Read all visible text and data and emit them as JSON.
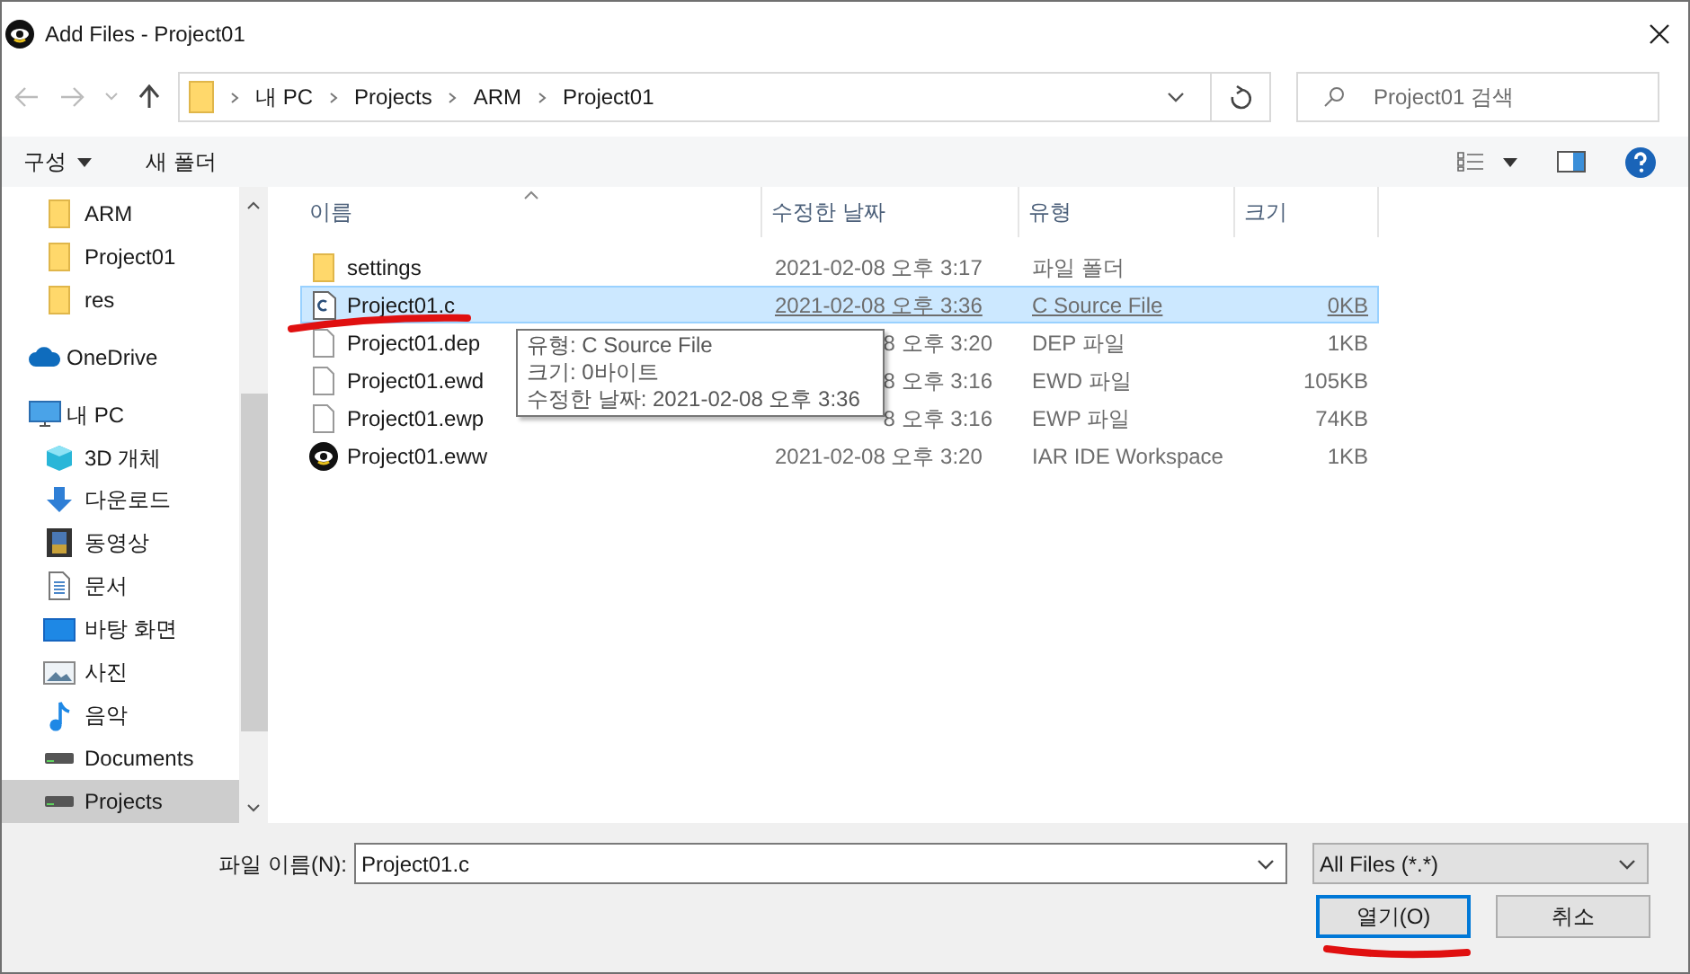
{
  "window": {
    "title": "Add Files - Project01"
  },
  "address_bar": {
    "path": [
      "내 PC",
      "Projects",
      "ARM",
      "Project01"
    ]
  },
  "search": {
    "placeholder": "Project01 검색"
  },
  "toolbar": {
    "organize": "구성",
    "new_folder": "새 폴더"
  },
  "sidebar": {
    "scrolled_children": [
      {
        "label": "ARM",
        "kind": "folder",
        "selected": false
      },
      {
        "label": "Project01",
        "kind": "folder",
        "selected": false
      },
      {
        "label": "res",
        "kind": "folder",
        "selected": false
      }
    ],
    "items": [
      {
        "label": "OneDrive",
        "kind": "cloud",
        "selected": false
      },
      {
        "label": "내 PC",
        "kind": "pc",
        "selected": false,
        "children": [
          {
            "label": "3D 개체",
            "kind": "cube",
            "selected": false
          },
          {
            "label": "다운로드",
            "kind": "download",
            "selected": false
          },
          {
            "label": "동영상",
            "kind": "film",
            "selected": false
          },
          {
            "label": "문서",
            "kind": "document",
            "selected": false
          },
          {
            "label": "바탕 화면",
            "kind": "desktop",
            "selected": false
          },
          {
            "label": "사진",
            "kind": "image",
            "selected": false
          },
          {
            "label": "음악",
            "kind": "music",
            "selected": false
          },
          {
            "label": "Documents",
            "kind": "drive",
            "selected": false
          },
          {
            "label": "Projects",
            "kind": "drive",
            "selected": true
          }
        ]
      }
    ]
  },
  "table": {
    "columns": [
      "이름",
      "수정한 날짜",
      "유형",
      "크기"
    ],
    "rows": [
      {
        "name": "settings",
        "date": "2021-02-08 오후 3:17",
        "type": "파일 폴더",
        "size": "",
        "kind": "folder",
        "selected": false
      },
      {
        "name": "Project01.c",
        "date": "2021-02-08 오후 3:36",
        "type": "C Source File",
        "size": "0KB",
        "kind": "c",
        "selected": true
      },
      {
        "name": "Project01.dep",
        "date": "8 오후 3:20",
        "type": "DEP 파일",
        "size": "1KB",
        "kind": "file",
        "selected": false
      },
      {
        "name": "Project01.ewd",
        "date": "8 오후 3:16",
        "type": "EWD 파일",
        "size": "105KB",
        "kind": "file",
        "selected": false
      },
      {
        "name": "Project01.ewp",
        "date": "8 오후 3:16",
        "type": "EWP 파일",
        "size": "74KB",
        "kind": "file",
        "selected": false
      },
      {
        "name": "Project01.eww",
        "date": "2021-02-08 오후 3:20",
        "type": "IAR IDE Workspace",
        "size": "1KB",
        "kind": "workspace",
        "selected": false
      }
    ]
  },
  "tooltip": {
    "lines": [
      "유형: C Source File",
      "크기: 0바이트",
      "수정한 날짜: 2021-02-08 오후 3:36"
    ]
  },
  "file_name": {
    "label": "파일 이름(N):",
    "value": "Project01.c"
  },
  "file_type": {
    "value": "All Files (*.*)"
  },
  "buttons": [
    {
      "label": "열기(O)",
      "kind": "primary"
    },
    {
      "label": "취소",
      "kind": "normal"
    }
  ]
}
